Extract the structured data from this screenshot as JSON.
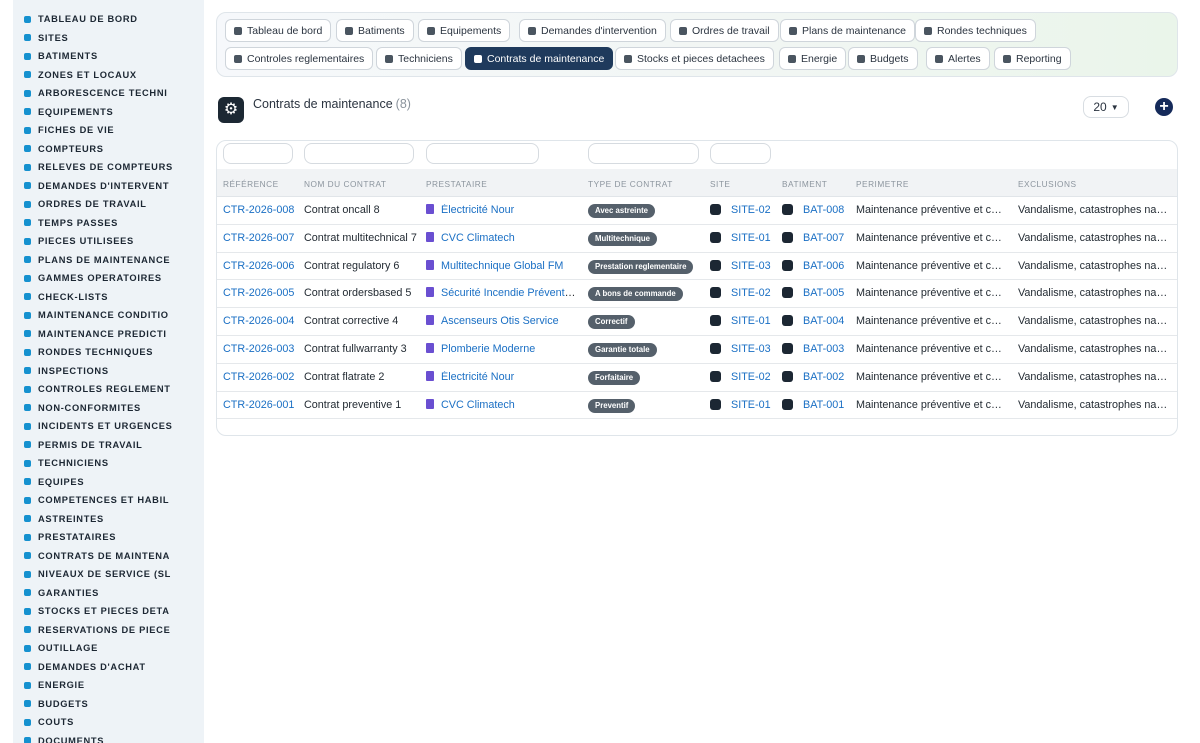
{
  "sidebar": {
    "items": [
      {
        "label": "TABLEAU DE BORD",
        "icon": "dashboard-icon"
      },
      {
        "label": "SITES",
        "icon": "location-pin-icon"
      },
      {
        "label": "BATIMENTS",
        "icon": "building-icon"
      },
      {
        "label": "ZONES ET LOCAUX",
        "icon": "zones-icon"
      },
      {
        "label": "ARBORESCENCE TECHNI",
        "icon": "tree-icon"
      },
      {
        "label": "EQUIPEMENTS",
        "icon": "gears-icon"
      },
      {
        "label": "FICHES DE VIE",
        "icon": "history-icon"
      },
      {
        "label": "COMPTEURS",
        "icon": "gauge-icon"
      },
      {
        "label": "RELEVES DE COMPTEURS",
        "icon": "chart-icon"
      },
      {
        "label": "DEMANDES D'INTERVENT",
        "icon": "question-icon"
      },
      {
        "label": "ORDRES DE TRAVAIL",
        "icon": "clipboard-icon"
      },
      {
        "label": "TEMPS PASSES",
        "icon": "clock-icon"
      },
      {
        "label": "PIECES UTILISEES",
        "icon": "boxes-icon"
      },
      {
        "label": "PLANS DE MAINTENANCE",
        "icon": "calendar-icon"
      },
      {
        "label": "GAMMES OPERATOIRES",
        "icon": "list-icon"
      },
      {
        "label": "CHECK-LISTS",
        "icon": "checklist-icon"
      },
      {
        "label": "MAINTENANCE CONDITIO",
        "icon": "thermometer-icon"
      },
      {
        "label": "MAINTENANCE PREDICTI",
        "icon": "predict-chart-icon"
      },
      {
        "label": "RONDES TECHNIQUES",
        "icon": "route-icon"
      },
      {
        "label": "INSPECTIONS",
        "icon": "magnifier-icon"
      },
      {
        "label": "CONTROLES REGLEMENT",
        "icon": "check-square-icon"
      },
      {
        "label": "NON-CONFORMITES",
        "icon": "alert-circle-icon"
      },
      {
        "label": "INCIDENTS ET URGENCES",
        "icon": "warning-triangle-icon"
      },
      {
        "label": "PERMIS DE TRAVAIL",
        "icon": "permit-icon"
      },
      {
        "label": "TECHNICIENS",
        "icon": "hard-hat-icon"
      },
      {
        "label": "EQUIPES",
        "icon": "users-icon"
      },
      {
        "label": "COMPETENCES ET HABIL",
        "icon": "certificate-icon"
      },
      {
        "label": "ASTREINTES",
        "icon": "phone-icon"
      },
      {
        "label": "PRESTATAIRES",
        "icon": "handshake-icon"
      },
      {
        "label": "CONTRATS DE MAINTENA",
        "icon": "contract-icon"
      },
      {
        "label": "NIVEAUX DE SERVICE (SL",
        "icon": "stopwatch-icon"
      },
      {
        "label": "GARANTIES",
        "icon": "shield-icon"
      },
      {
        "label": "STOCKS ET PIECES DETA",
        "icon": "stock-icon"
      },
      {
        "label": "RESERVATIONS DE PIECE",
        "icon": "bookmark-icon"
      },
      {
        "label": "OUTILLAGE",
        "icon": "tools-icon"
      },
      {
        "label": "DEMANDES D'ACHAT",
        "icon": "cart-icon"
      },
      {
        "label": "ENERGIE",
        "icon": "bolt-icon"
      },
      {
        "label": "BUDGETS",
        "icon": "budget-icon"
      },
      {
        "label": "COUTS",
        "icon": "invoice-icon"
      },
      {
        "label": "DOCUMENTS",
        "icon": "document-icon"
      }
    ]
  },
  "nav": {
    "row1": [
      {
        "label": "Tableau de bord",
        "icon": "dashboard-icon"
      },
      {
        "label": "Batiments",
        "icon": "building-icon"
      },
      {
        "label": "Equipements",
        "icon": "gears-icon"
      },
      {
        "label": "Demandes d'intervention",
        "icon": "question-icon"
      },
      {
        "label": "Ordres de travail",
        "icon": "clipboard-icon"
      },
      {
        "label": "Plans de maintenance",
        "icon": "calendar-icon"
      },
      {
        "label": "Rondes techniques",
        "icon": "route-icon"
      }
    ],
    "row2": [
      {
        "label": "Controles reglementaires",
        "icon": "check-square-icon"
      },
      {
        "label": "Techniciens",
        "icon": "hard-hat-icon"
      },
      {
        "label": "Contrats de maintenance",
        "icon": "contract-icon",
        "active": true
      },
      {
        "label": "Stocks et pieces detachees",
        "icon": "stock-icon"
      },
      {
        "label": "Energie",
        "icon": "bolt-icon"
      },
      {
        "label": "Budgets",
        "icon": "budget-icon"
      },
      {
        "label": "Alertes",
        "icon": "bell-icon"
      },
      {
        "label": "Reporting",
        "icon": "pie-chart-icon"
      }
    ]
  },
  "page": {
    "title": "Contrats de maintenance",
    "count": "(8)",
    "icon": "gears-icon",
    "per_page": "20"
  },
  "table": {
    "headers": [
      "RÉFÉRENCE",
      "NOM DU CONTRAT",
      "PRESTATAIRE",
      "TYPE DE CONTRAT",
      "SITE",
      "BATIMENT",
      "PERIMETRE",
      "EXCLUSIONS"
    ],
    "rows": [
      {
        "ref": "CTR-2026-008",
        "name": "Contrat oncall 8",
        "provider": "Électricité Nour",
        "type": "Avec astreinte",
        "site": "SITE-02",
        "building": "BAT-008",
        "scope": "Maintenance préventive et corrective",
        "exclusions": "Vandalisme, catastrophes naturelles"
      },
      {
        "ref": "CTR-2026-007",
        "name": "Contrat multitechnical 7",
        "provider": "CVC Climatech",
        "type": "Multitechnique",
        "site": "SITE-01",
        "building": "BAT-007",
        "scope": "Maintenance préventive et corrective",
        "exclusions": "Vandalisme, catastrophes naturelles"
      },
      {
        "ref": "CTR-2026-006",
        "name": "Contrat regulatory 6",
        "provider": "Multitechnique Global FM",
        "type": "Prestation reglementaire",
        "site": "SITE-03",
        "building": "BAT-006",
        "scope": "Maintenance préventive et corrective",
        "exclusions": "Vandalisme, catastrophes naturelles"
      },
      {
        "ref": "CTR-2026-005",
        "name": "Contrat ordersbased 5",
        "provider": "Sécurité Incendie Prévention",
        "type": "A bons de commande",
        "site": "SITE-02",
        "building": "BAT-005",
        "scope": "Maintenance préventive et corrective",
        "exclusions": "Vandalisme, catastrophes naturelles"
      },
      {
        "ref": "CTR-2026-004",
        "name": "Contrat corrective 4",
        "provider": "Ascenseurs Otis Service",
        "type": "Correctif",
        "site": "SITE-01",
        "building": "BAT-004",
        "scope": "Maintenance préventive et corrective",
        "exclusions": "Vandalisme, catastrophes naturelles"
      },
      {
        "ref": "CTR-2026-003",
        "name": "Contrat fullwarranty 3",
        "provider": "Plomberie Moderne",
        "type": "Garantie totale",
        "site": "SITE-03",
        "building": "BAT-003",
        "scope": "Maintenance préventive et corrective",
        "exclusions": "Vandalisme, catastrophes naturelles"
      },
      {
        "ref": "CTR-2026-002",
        "name": "Contrat flatrate 2",
        "provider": "Électricité Nour",
        "type": "Forfaitaire",
        "site": "SITE-02",
        "building": "BAT-002",
        "scope": "Maintenance préventive et corrective",
        "exclusions": "Vandalisme, catastrophes naturelles"
      },
      {
        "ref": "CTR-2026-001",
        "name": "Contrat preventive 1",
        "provider": "CVC Climatech",
        "type": "Preventif",
        "site": "SITE-01",
        "building": "BAT-001",
        "scope": "Maintenance préventive et corrective",
        "exclusions": "Vandalisme, catastrophes naturelles"
      }
    ]
  },
  "colors": {
    "accent": "#1f3a5c",
    "link": "#1a6fc4",
    "badge": "#55606b",
    "sidebar_bg": "#eef3f7",
    "add_button": "#152a5a"
  }
}
